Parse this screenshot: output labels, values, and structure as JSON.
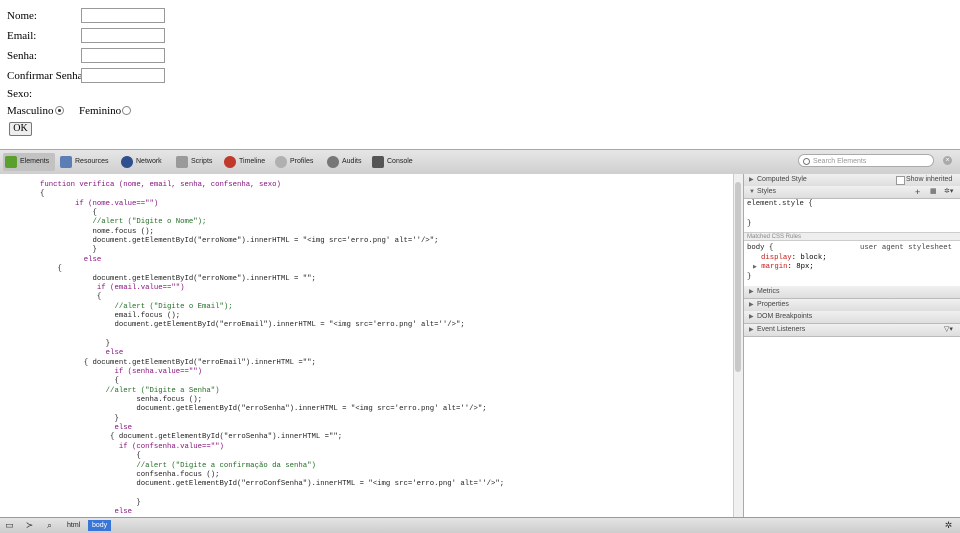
{
  "form": {
    "labels": [
      "Nome:",
      "Email:",
      "Senha:",
      "Confirmar Senha:"
    ],
    "sexo_label": "Sexo:",
    "masculino": "Masculino",
    "feminino": "Feminino",
    "ok": "OK"
  },
  "toolbar": {
    "tabs": [
      "Elements",
      "Resources",
      "Network",
      "Scripts",
      "Timeline",
      "Profiles",
      "Audits",
      "Console"
    ],
    "search_placeholder": "Search Elements"
  },
  "code": [
    "function verifica (nome, email, senha, confsenha, sexo)",
    "{",
    "        if (nome.value==\"\")",
    "            {",
    "            //alert (\"Digite o Nome\");",
    "            nome.focus ();",
    "            document.getElementById(\"erroNome\").innerHTML = \"<img src='erro.png' alt=''/>\";",
    "            }",
    "          else",
    "    {",
    "            document.getElementById(\"erroNome\").innerHTML = \"\";",
    "             if (email.value==\"\")",
    "             {",
    "                 //alert (\"Digite o Email\");",
    "                 email.focus ();",
    "                 document.getElementById(\"erroEmail\").innerHTML = \"<img src='erro.png' alt=''/>\";",
    "",
    "               }",
    "               else",
    "          { document.getElementById(\"erroEmail\").innerHTML =\"\";",
    "                 if (senha.value==\"\")",
    "                 {",
    "               //alert (\"Digite a Senha\")",
    "                      senha.focus ();",
    "                      document.getElementById(\"erroSenha\").innerHTML = \"<img src='erro.png' alt=''/>\";",
    "                 }",
    "                 else",
    "                { document.getElementById(\"erroSenha\").innerHTML =\"\";",
    "                  if (confsenha.value==\"\")",
    "                      {",
    "                      //alert (\"Digite a confirmação da senha\")",
    "                      confsenha.focus ();",
    "                      document.getElementById(\"erroConfSenha\").innerHTML = \"<img src='erro.png' alt=''/>\";",
    "",
    "                      }",
    "                 else"
  ],
  "sidebar": {
    "computed_style": "Computed Style",
    "show_inherited": "Show inherited",
    "styles": "Styles",
    "element_style": "element.style {",
    "close_brace": "}",
    "matched_rules": "Matched CSS Rules",
    "body_selector": "body {",
    "user_agent": "user agent stylesheet",
    "prop1_name": "display",
    "prop1_value": "block;",
    "prop2_name": "margin",
    "prop2_value": "8px;",
    "metrics": "Metrics",
    "properties": "Properties",
    "dom_breakpoints": "DOM Breakpoints",
    "event_listeners": "Event Listeners"
  },
  "status": {
    "crumbs": [
      "html",
      "body"
    ]
  }
}
